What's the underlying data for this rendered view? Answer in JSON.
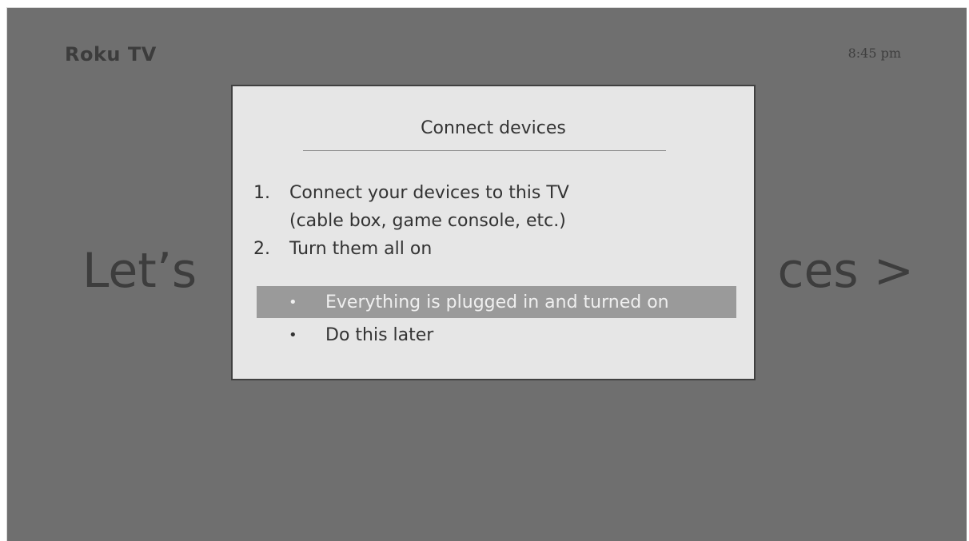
{
  "header": {
    "logo": "Roku TV",
    "time": "8:45 pm"
  },
  "background": {
    "heading_left": "Let’s",
    "heading_right": "ces >"
  },
  "dialog": {
    "title": "Connect devices",
    "steps": [
      {
        "number": "1.",
        "lines": [
          "Connect your devices to this TV",
          "(cable box, game console, etc.)"
        ]
      },
      {
        "number": "2.",
        "lines": [
          "Turn them all on"
        ]
      }
    ],
    "options": [
      {
        "label": "Everything is plugged in and turned on",
        "selected": true
      },
      {
        "label": "Do this later",
        "selected": false
      }
    ],
    "bullet": "•"
  }
}
